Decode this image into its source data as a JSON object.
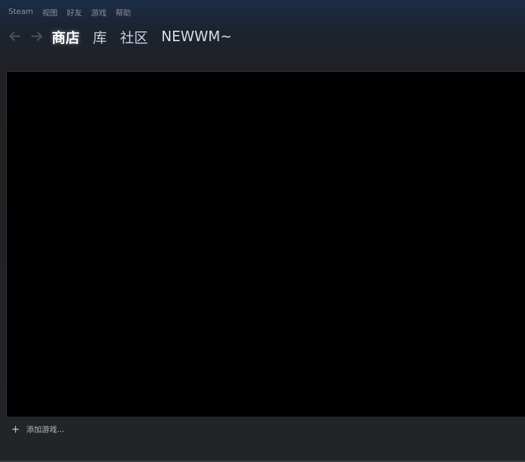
{
  "menu": {
    "items": [
      "Steam",
      "视图",
      "好友",
      "游戏",
      "帮助"
    ]
  },
  "nav": {
    "back_icon": "arrow-left-icon",
    "forward_icon": "arrow-right-icon",
    "tabs": [
      {
        "label": "商店",
        "active": true
      },
      {
        "label": "库",
        "active": false
      },
      {
        "label": "社区",
        "active": false
      }
    ],
    "username": "NEWWM~"
  },
  "footer": {
    "add_game_label": "添加游戏...",
    "add_icon": "plus-icon"
  },
  "colors": {
    "accent_text": "#c6d4df",
    "content_background": "#000000"
  }
}
